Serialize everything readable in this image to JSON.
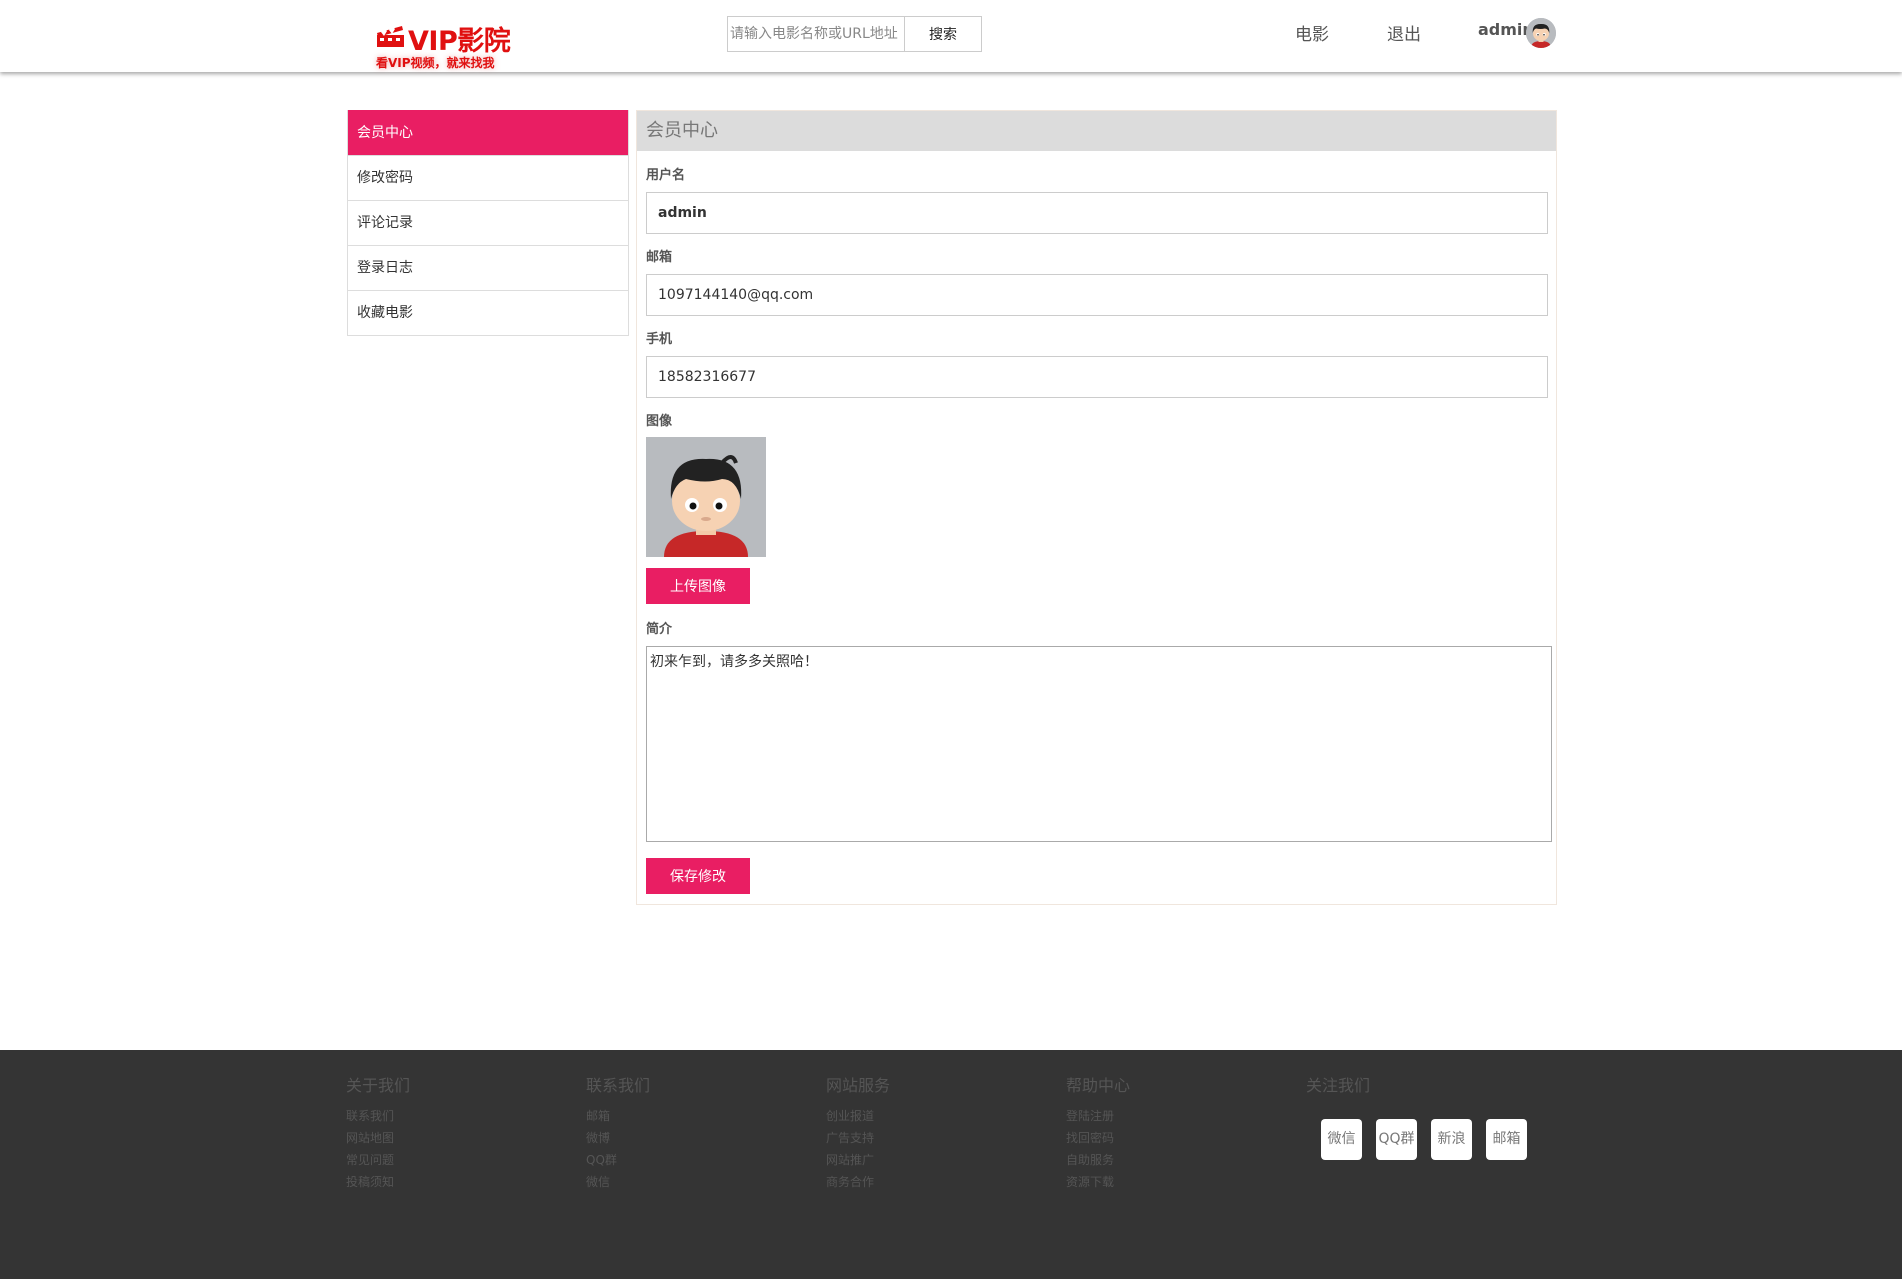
{
  "header": {
    "logo_title": "VIP影院",
    "logo_subtitle": "看VIP视频，就来找我",
    "search_placeholder": "请输入电影名称或URL地址",
    "search_button": "搜索",
    "nav_movie": "电影",
    "nav_logout": "退出",
    "username": "admin"
  },
  "sidebar": {
    "items": [
      {
        "label": "会员中心",
        "active": true
      },
      {
        "label": "修改密码",
        "active": false
      },
      {
        "label": "评论记录",
        "active": false
      },
      {
        "label": "登录日志",
        "active": false
      },
      {
        "label": "收藏电影",
        "active": false
      }
    ]
  },
  "panel": {
    "title": "会员中心",
    "username_label": "用户名",
    "username_value": "admin",
    "email_label": "邮箱",
    "email_value": "1097144140@qq.com",
    "phone_label": "手机",
    "phone_value": "18582316677",
    "avatar_label": "图像",
    "upload_button": "上传图像",
    "bio_label": "简介",
    "bio_value": "初来乍到，请多多关照哈！",
    "save_button": "保存修改"
  },
  "footer": {
    "columns": [
      {
        "title": "关于我们",
        "links": [
          "联系我们",
          "网站地图",
          "常见问题",
          "投稿须知"
        ]
      },
      {
        "title": "联系我们",
        "links": [
          "邮箱",
          "微博",
          "QQ群",
          "微信"
        ]
      },
      {
        "title": "网站服务",
        "links": [
          "创业报道",
          "广告支持",
          "网站推广",
          "商务合作"
        ]
      },
      {
        "title": "帮助中心",
        "links": [
          "登陆注册",
          "找回密码",
          "自助服务",
          "资源下载"
        ]
      }
    ],
    "follow_title": "关注我们",
    "social": [
      "微信",
      "QQ群",
      "新浪",
      "邮箱"
    ]
  },
  "colors": {
    "accent": "#e91e63",
    "logo": "#e01010",
    "footer_bg": "#343434"
  },
  "icons": [
    "clapperboard-icon",
    "avatar-icon"
  ]
}
